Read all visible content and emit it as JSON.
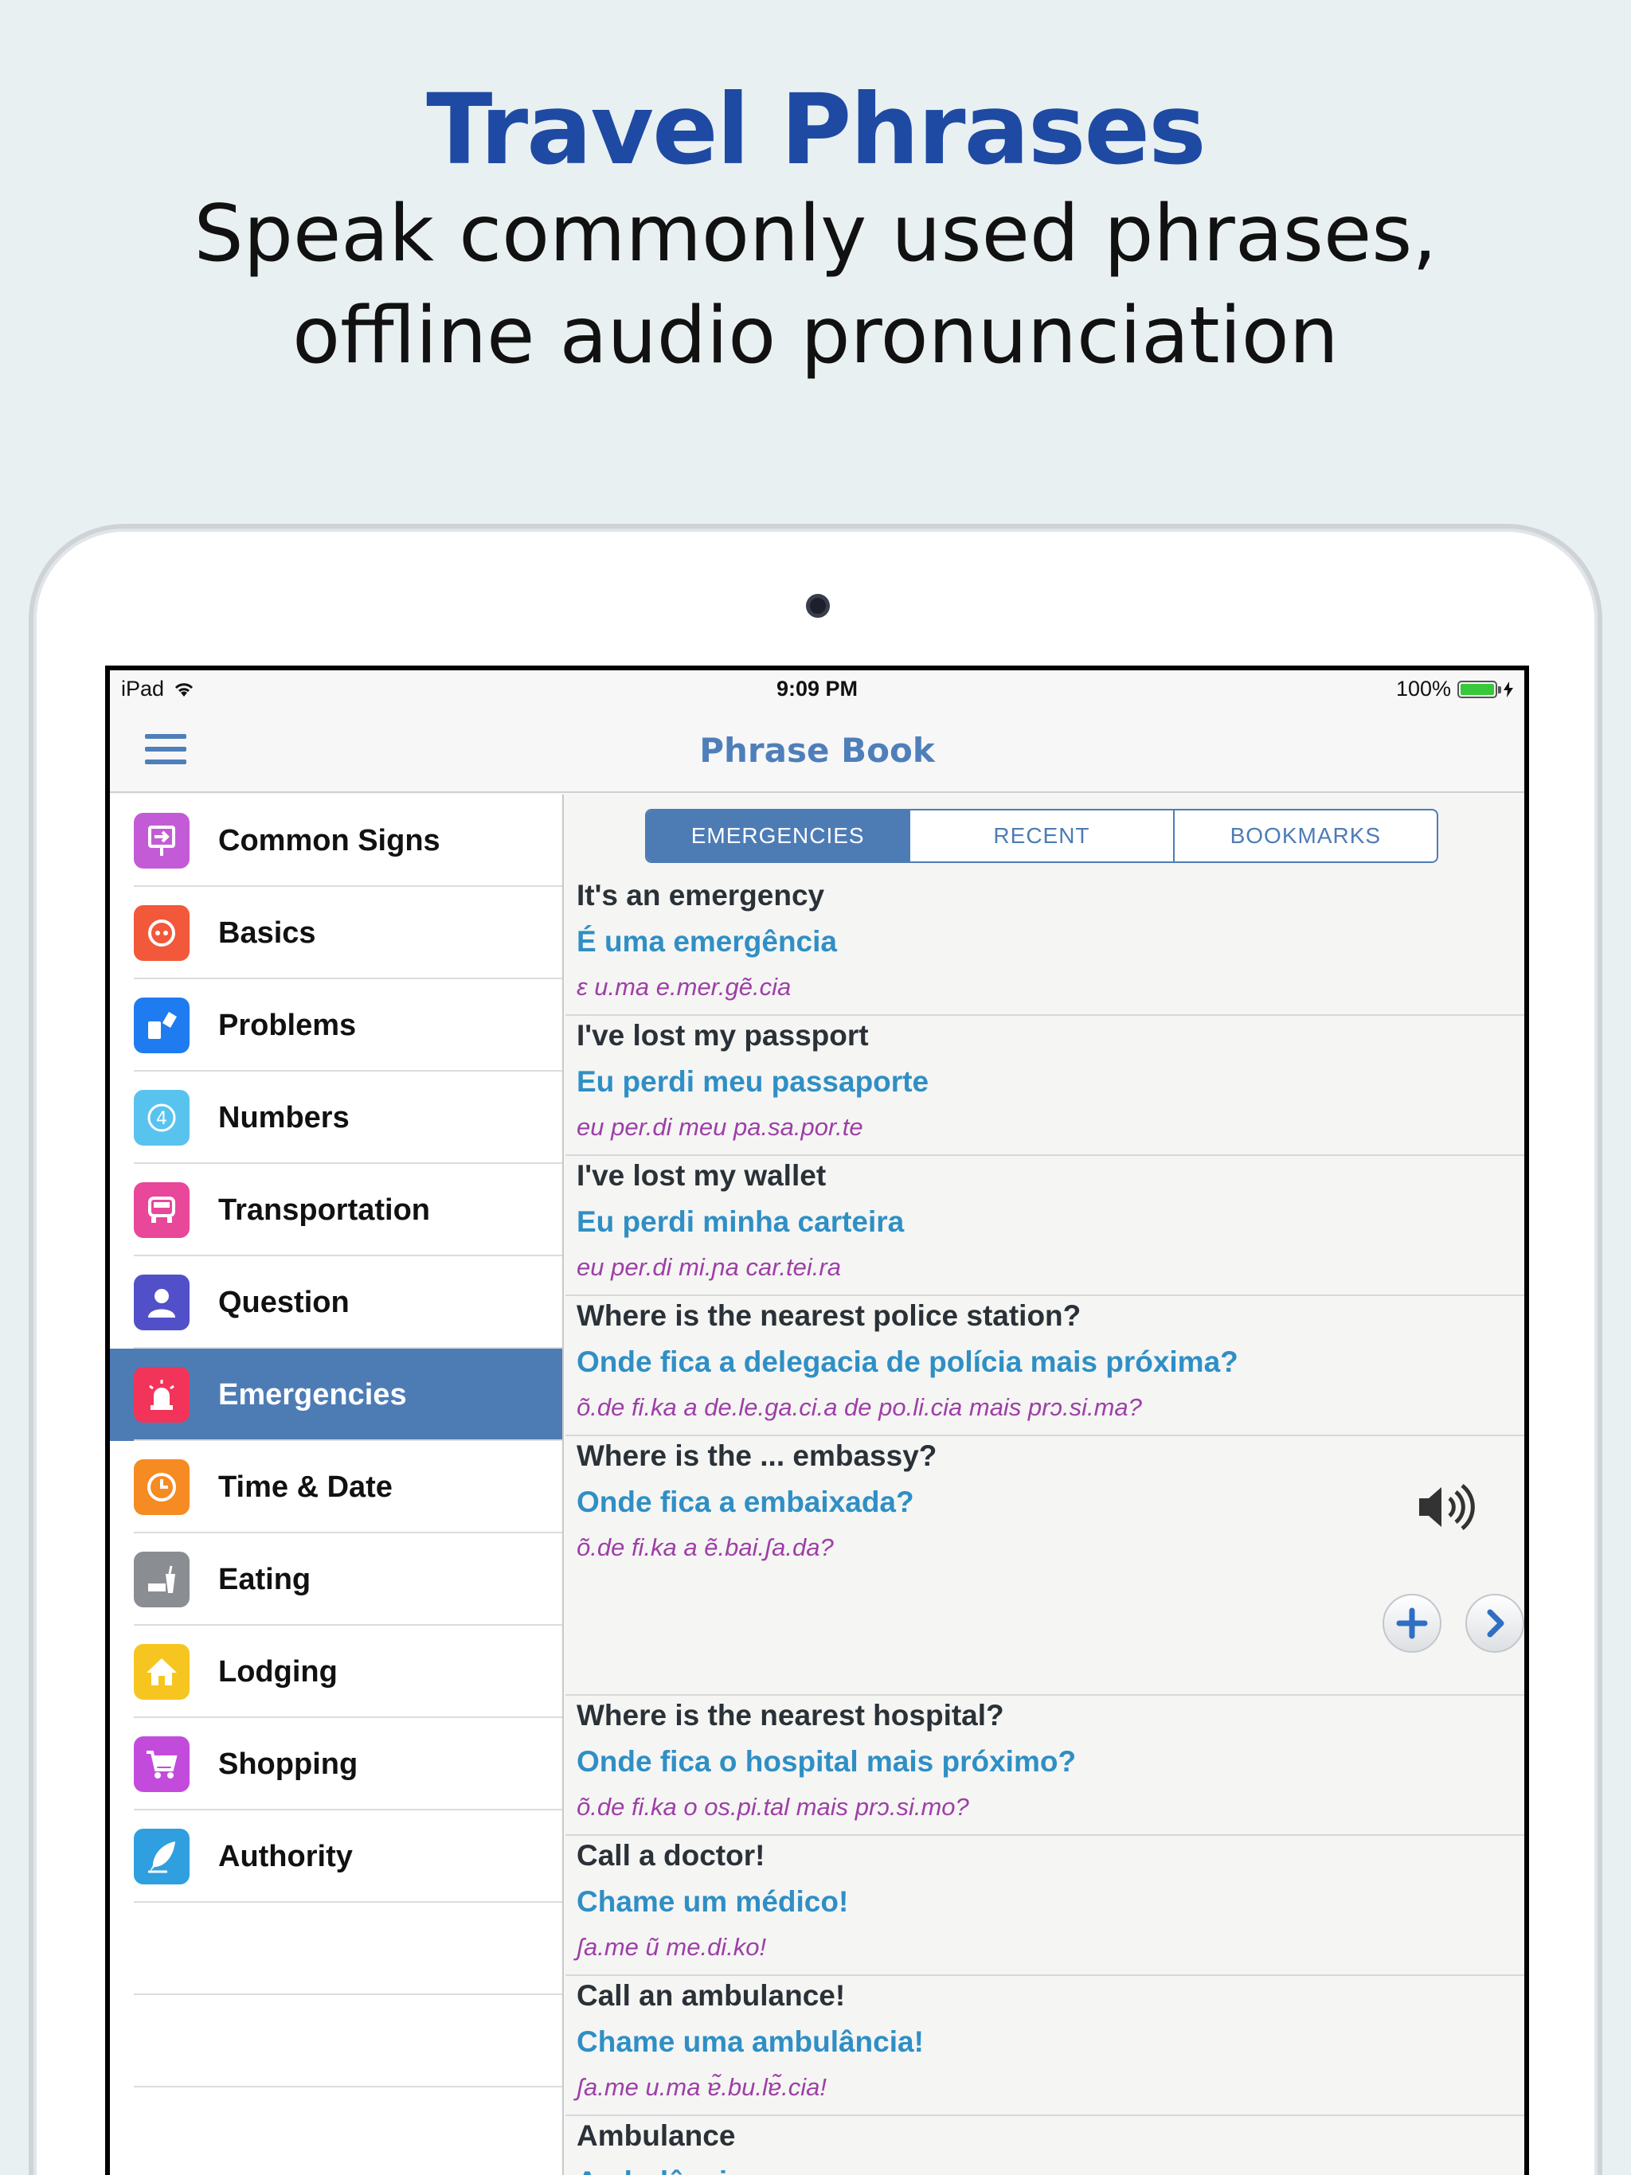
{
  "promo": {
    "title": "Travel Phrases",
    "subtitle_line1": "Speak commonly used phrases,",
    "subtitle_line2": "offline audio pronunciation"
  },
  "status_bar": {
    "device": "iPad",
    "time": "9:09 PM",
    "battery": "100%"
  },
  "nav": {
    "title": "Phrase Book"
  },
  "sidebar": {
    "items": [
      {
        "label": "Common Signs",
        "icon": "sign-icon",
        "color": "#c45bd6"
      },
      {
        "label": "Basics",
        "icon": "basics-icon",
        "color": "#f2583a"
      },
      {
        "label": "Problems",
        "icon": "problems-icon",
        "color": "#1f7cf0"
      },
      {
        "label": "Numbers",
        "icon": "numbers-icon",
        "color": "#59c3f0"
      },
      {
        "label": "Transportation",
        "icon": "car-icon",
        "color": "#e8479a"
      },
      {
        "label": "Question",
        "icon": "person-icon",
        "color": "#5250c9"
      },
      {
        "label": "Emergencies",
        "icon": "siren-icon",
        "color": "#f2345a"
      },
      {
        "label": "Time & Date",
        "icon": "clock-icon",
        "color": "#f58b22"
      },
      {
        "label": "Eating",
        "icon": "food-icon",
        "color": "#8a8d92"
      },
      {
        "label": "Lodging",
        "icon": "house-icon",
        "color": "#f7c520"
      },
      {
        "label": "Shopping",
        "icon": "cart-icon",
        "color": "#c34bdc"
      },
      {
        "label": "Authority",
        "icon": "quill-icon",
        "color": "#2f9fe0"
      }
    ],
    "active_index": 6
  },
  "tabs": [
    {
      "label": "EMERGENCIES",
      "active": true
    },
    {
      "label": "RECENT",
      "active": false
    },
    {
      "label": "BOOKMARKS",
      "active": false
    }
  ],
  "phrases": [
    {
      "en": "It's an emergency",
      "pt": "É uma emergência",
      "ipa": "ɛ u.ma e.mer.gẽ.cia"
    },
    {
      "en": "I've lost my passport",
      "pt": "Eu perdi meu passaporte",
      "ipa": "eu per.di meu pa.sa.por.te"
    },
    {
      "en": "I've lost my wallet",
      "pt": "Eu perdi minha carteira",
      "ipa": "eu per.di mi.ɲa car.tei.ra"
    },
    {
      "en": "Where is the nearest police station?",
      "pt": "Onde fica a delegacia de polícia mais próxima?",
      "ipa": "õ.de fi.ka a de.le.ga.ci.a de po.li.cia mais prɔ.si.ma?"
    },
    {
      "en": "Where is the ... embassy?",
      "pt": "Onde fica a embaixada?",
      "ipa": "õ.de fi.ka a ẽ.bai.ʃa.da?"
    },
    {
      "en": "Where is the nearest hospital?",
      "pt": "Onde fica o hospital mais próximo?",
      "ipa": "õ.de fi.ka o os.pi.tal mais prɔ.si.mo?"
    },
    {
      "en": "Call a doctor!",
      "pt": "Chame um médico!",
      "ipa": "ʃa.me ũ me.di.ko!"
    },
    {
      "en": "Call an ambulance!",
      "pt": "Chame uma ambulância!",
      "ipa": "ʃa.me u.ma ɐ̃.bu.lɐ̃.cia!"
    },
    {
      "en": "Ambulance",
      "pt": "Ambulância",
      "ipa": ""
    }
  ]
}
